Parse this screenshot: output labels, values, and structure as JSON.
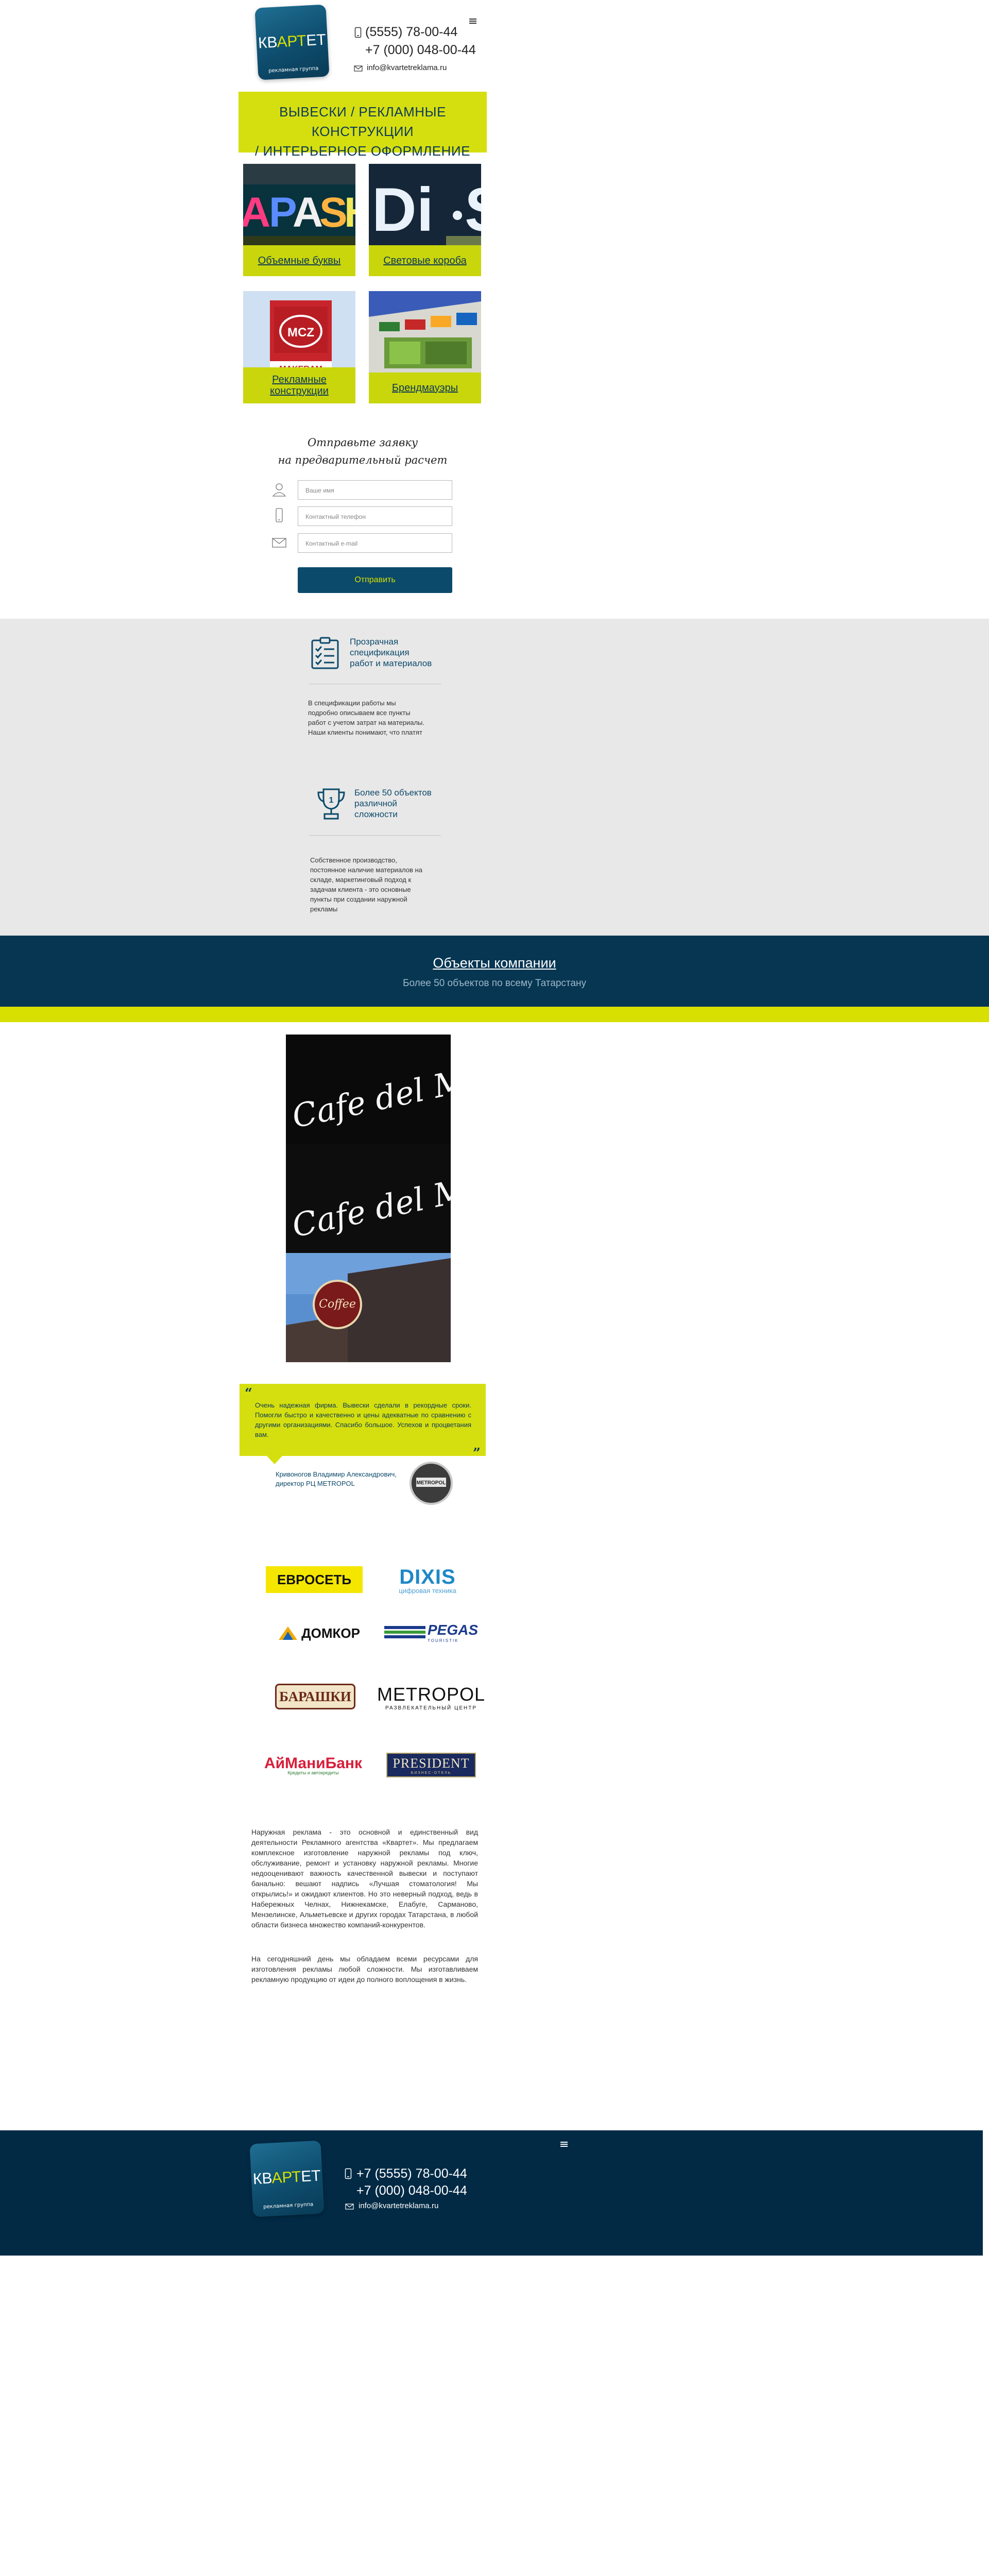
{
  "header": {
    "logo": {
      "name": "КВАРТЕТ",
      "part1": "КВ",
      "part2": "АРТ",
      "part3": "ЕТ",
      "tagline": "рекламная группа"
    },
    "phone1": "(5555) 78-00-44",
    "phone2": "+7 (000) 048-00-44",
    "email": "info@kvartetreklama.ru"
  },
  "banner": {
    "line1": "ВЫВЕСКИ / РЕКЛАМНЫЕ КОНСТРУКЦИИ",
    "line2": "/ ИНТЕРЬЕРНОЕ ОФОРМЛЕНИЕ"
  },
  "services": [
    {
      "label": "Объемные буквы",
      "image_text": "APASH"
    },
    {
      "label": "Световые короба",
      "image_text": "Di·S"
    },
    {
      "label": "Рекламные конструкции",
      "image_text": "MAKERAM"
    },
    {
      "label": "Брендмауэры"
    }
  ],
  "form": {
    "title_line1": "Отправьте заявку",
    "title_line2": "на предварительный расчет",
    "name_placeholder": "Ваше имя",
    "phone_placeholder": "Контактный телефон",
    "email_placeholder": "Контактный e-mail",
    "submit": "Отправить"
  },
  "features": [
    {
      "icon": "checklist-icon",
      "title_lines": [
        "Прозрачная",
        "спецификация",
        "работ и материалов"
      ],
      "text_lines": [
        "В спецификации работы мы",
        "подробно описываем все пункты",
        "работ с учетом затрат на материалы.",
        "Наши клиенты понимают, что платят"
      ]
    },
    {
      "icon": "trophy-icon",
      "title_lines": [
        "Более 50 объектов",
        "различной",
        "сложности"
      ],
      "text_lines": [
        "Собственное производство,",
        "постоянное наличие материалов на",
        "складе, маркетинговый подход к",
        "задачам клиента - это основные",
        "пункты при создании наружной",
        "рекламы"
      ]
    }
  ],
  "objects": {
    "title": "Объекты компании",
    "subtitle": "Более 50 объектов по всему Татарстану"
  },
  "photos": [
    "Cafe del Mar",
    "Cafe del Mar",
    "Coffee"
  ],
  "review": {
    "text": "Очень надежная фирма. Вывески сделали в рекордные сроки. Помогли быстро и качественно и цены адекватные по сравнению с другими организациями. Спасибо большое. Успехов и процветания вам.",
    "author_line1": "Кривоногов Владимир Александрович,",
    "author_line2": "директор РЦ METROPOL",
    "avatar_text": "METROPOL"
  },
  "brands": [
    {
      "name": "ЕВРОСЕТЬ"
    },
    {
      "name": "DIXIS",
      "sub": "цифровая техника"
    },
    {
      "name": "ДОМКОР"
    },
    {
      "name": "PEGAS",
      "sub": "TOURISTIK"
    },
    {
      "name": "БАРАШКИ"
    },
    {
      "name": "METROPOL",
      "sub": "РАЗВЛЕКАТЕЛЬНЫЙ ЦЕНТР"
    },
    {
      "name": "АйМаниБанк",
      "sub": "Кредиты и автокредиты"
    },
    {
      "name": "PRESIDENT",
      "sub": "БИЗНЕС-ОТЕЛЬ"
    }
  ],
  "seo": {
    "p1": "Наружная реклама - это основной и единственный вид деятельности Рекламного агентства «Квартет». Мы предлагаем комплексное изготовление наружной рекламы под ключ, обслуживание, ремонт и установку наружной рекламы. Многие недооценивают важность качественной вывески и поступают банально: вешают надпись «Лучшая стоматология! Мы открылись!» и ожидают клиентов. Но это неверный подход, ведь в Набережных Челнах, Нижнекамске, Елабуге, Сарманово, Мензелинске, Альметьевске и других городах Татарстана, в любой области бизнеса множество компаний-конкурентов.",
    "p2": "На сегодняшний день мы обладаем всеми ресурсами для изготовления рекламы любой сложности. Мы изготавливаем рекламную продукцию от идеи до полного воплощения в жизнь."
  },
  "colors": {
    "accent": "#d5df0f",
    "navy": "#063652",
    "footer": "#022a45",
    "gray": "#e8e8e8"
  }
}
